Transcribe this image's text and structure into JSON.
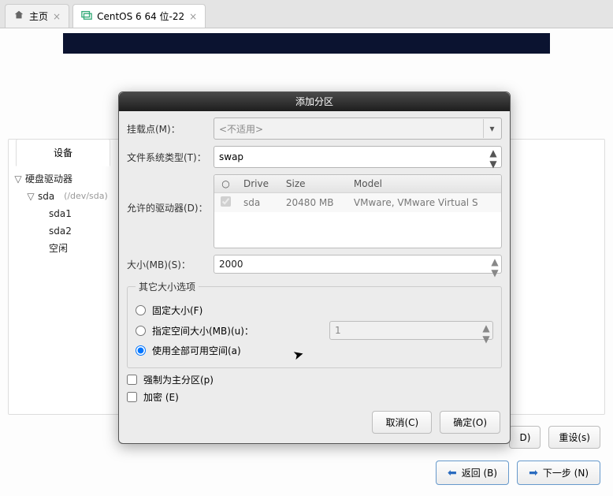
{
  "tabs": {
    "home": "主页",
    "vm": "CentOS 6 64 位-22"
  },
  "bg": {
    "device_tab": "设备",
    "tree": {
      "root": "硬盘驱动器",
      "disk": "sda",
      "disk_path": "(/dev/sda)",
      "p1": "sda1",
      "p2": "sda2",
      "free": "空闲"
    },
    "delete_btn": "D)",
    "reset_btn": "重设(s)",
    "back_btn": "返回 (B)",
    "next_btn": "下一步 (N)"
  },
  "modal": {
    "title": "添加分区",
    "mount_label": "挂载点(M)：",
    "mount_value": "<不适用>",
    "fstype_label": "文件系统类型(T)：",
    "fstype_value": "swap",
    "drives_label": "允许的驱动器(D)：",
    "drives_hdr_drive": "Drive",
    "drives_hdr_size": "Size",
    "drives_hdr_model": "Model",
    "drive_name": "sda",
    "drive_size": "20480 MB",
    "drive_model": "VMware, VMware Virtual S",
    "size_label": "大小(MB)(S)：",
    "size_value": "2000",
    "group_legend": "其它大小选项",
    "opt_fixed": "固定大小(F)",
    "opt_upto": "指定空间大小(MB)(u)：",
    "opt_upto_value": "1",
    "opt_fill": "使用全部可用空间(a)",
    "chk_primary": "强制为主分区(p)",
    "chk_encrypt": "加密 (E)",
    "cancel": "取消(C)",
    "ok": "确定(O)"
  }
}
